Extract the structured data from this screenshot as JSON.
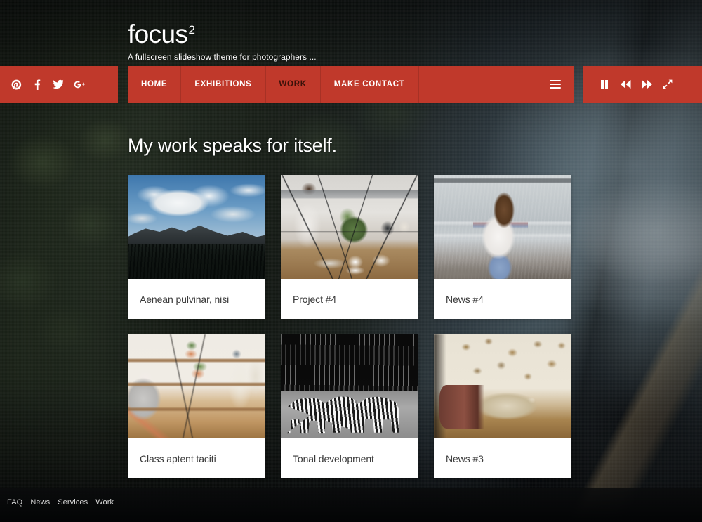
{
  "site": {
    "brand": "focus",
    "brand_sup": "2",
    "tagline": "A fullscreen slideshow theme for photographers  ..."
  },
  "colors": {
    "accent_red": "#c0392b",
    "nav_active_text": "#3a1109",
    "card_background": "#ffffff",
    "caption_text": "#3a3a3a",
    "footer_background": "#060708"
  },
  "social": {
    "items": [
      {
        "name": "pinterest",
        "label": "Pinterest",
        "icon": "pinterest-icon"
      },
      {
        "name": "facebook",
        "label": "Facebook",
        "icon": "facebook-icon"
      },
      {
        "name": "twitter",
        "label": "Twitter",
        "icon": "twitter-icon"
      },
      {
        "name": "googleplus",
        "label": "Google Plus",
        "icon": "google-plus-icon"
      }
    ]
  },
  "nav": {
    "items": [
      {
        "label": "HOME",
        "active": false
      },
      {
        "label": "EXHIBITIONS",
        "active": false
      },
      {
        "label": "WORK",
        "active": true
      },
      {
        "label": "MAKE CONTACT",
        "active": false
      }
    ],
    "toggle_icon": "hamburger-menu-icon"
  },
  "player": {
    "controls": [
      {
        "name": "pause",
        "label": "Pause",
        "icon": "pause-icon"
      },
      {
        "name": "previous",
        "label": "Previous",
        "icon": "rewind-icon"
      },
      {
        "name": "next",
        "label": "Next",
        "icon": "fast-forward-icon"
      },
      {
        "name": "fullscreen",
        "label": "Fullscreen",
        "icon": "expand-arrows-icon"
      }
    ]
  },
  "main": {
    "title": "My work speaks for itself.",
    "cards": [
      {
        "caption": "Aenean pulvinar, nisi",
        "thumb": "thumb-mountain",
        "alt": "mountain-landscape-photo"
      },
      {
        "caption": "Project #4",
        "thumb": "thumb-kitchen",
        "alt": "kitchen-terrarium-photo"
      },
      {
        "caption": "News #4",
        "thumb": "thumb-beach",
        "alt": "woman-at-beach-photo"
      },
      {
        "caption": "Class aptent taciti",
        "thumb": "thumb-living",
        "alt": "living-room-interior-photo"
      },
      {
        "caption": "Tonal development",
        "thumb": "thumb-zebra",
        "alt": "zebras-black-and-white-photo"
      },
      {
        "caption": "News #3",
        "thumb": "thumb-journal",
        "alt": "leather-journal-photo"
      }
    ]
  },
  "footer": {
    "links": [
      "FAQ",
      "News",
      "Services",
      "Work"
    ]
  }
}
